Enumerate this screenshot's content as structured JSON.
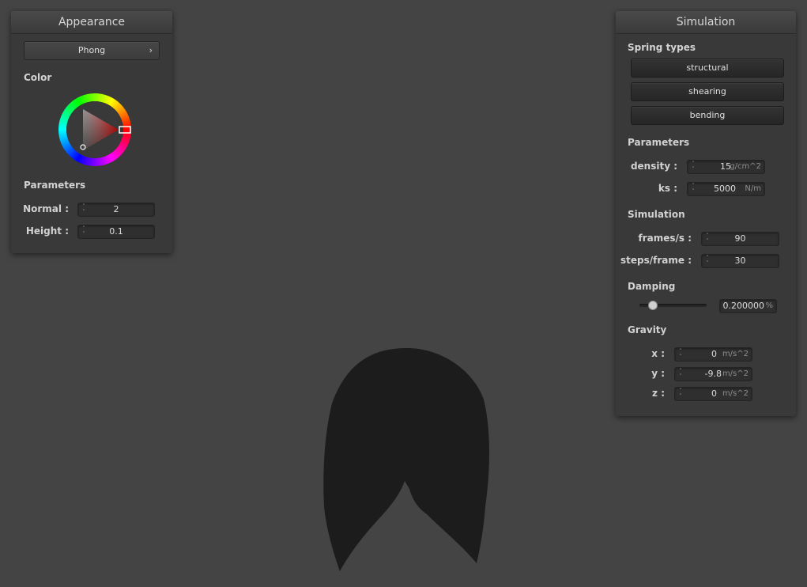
{
  "appearance": {
    "title": "Appearance",
    "shader": "Phong",
    "color_label": "Color",
    "parameters_label": "Parameters",
    "normal": {
      "label": "Normal :",
      "value": "2"
    },
    "height": {
      "label": "Height :",
      "value": "0.1"
    }
  },
  "simulation": {
    "title": "Simulation",
    "spring_types_label": "Spring types",
    "springs": [
      "structural",
      "shearing",
      "bending"
    ],
    "parameters_label": "Parameters",
    "density": {
      "label": "density :",
      "value": "15",
      "unit": "g/cm^2"
    },
    "ks": {
      "label": "ks :",
      "value": "5000",
      "unit": "N/m"
    },
    "sim_label": "Simulation",
    "fps": {
      "label": "frames/s :",
      "value": "90"
    },
    "steps": {
      "label": "steps/frame :",
      "value": "30"
    },
    "damping_label": "Damping",
    "damping": {
      "value": "0.200000",
      "unit": "%",
      "slider_fraction": 0.2
    },
    "gravity_label": "Gravity",
    "gx": {
      "label": "x :",
      "value": "0",
      "unit": "m/s^2"
    },
    "gy": {
      "label": "y :",
      "value": "-9.8",
      "unit": "m/s^2"
    },
    "gz": {
      "label": "z :",
      "value": "0",
      "unit": "m/s^2"
    }
  },
  "colors": {
    "background": "#444444",
    "cloth": "#1c1c1c",
    "panel": "#393939"
  },
  "icons": {
    "combo_chevron": "chevron-right-icon",
    "spinner": "spinner-arrows-icon"
  }
}
